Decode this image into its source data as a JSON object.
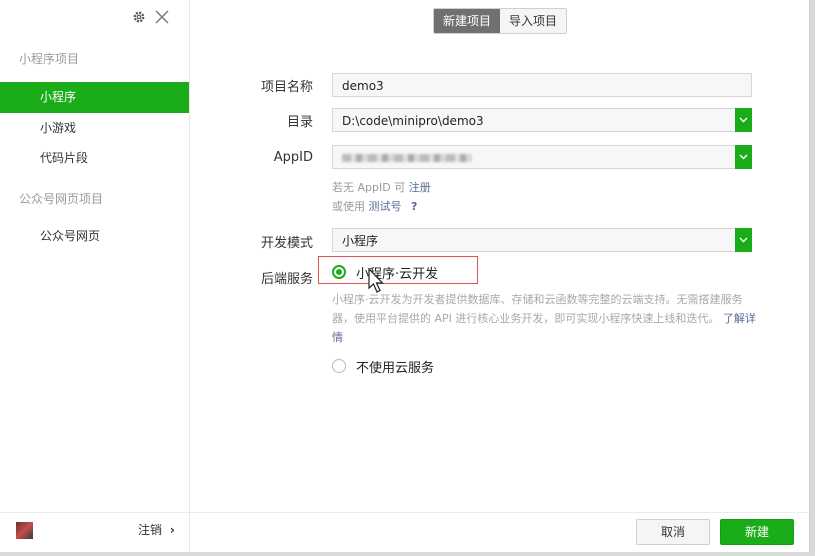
{
  "sidebar": {
    "groups": [
      {
        "title": "小程序项目",
        "items": [
          {
            "label": "小程序",
            "active": true
          },
          {
            "label": "小游戏",
            "active": false
          },
          {
            "label": "代码片段",
            "active": false
          }
        ]
      },
      {
        "title": "公众号网页项目",
        "items": [
          {
            "label": "公众号网页",
            "active": false
          }
        ]
      }
    ],
    "logout_label": "注销",
    "logout_chevron": "›"
  },
  "tabs": [
    {
      "label": "新建项目",
      "active": true
    },
    {
      "label": "导入项目",
      "active": false
    }
  ],
  "form": {
    "project_name": {
      "label": "项目名称",
      "value": "demo3"
    },
    "directory": {
      "label": "目录",
      "value": "D:\\code\\minipro\\demo3"
    },
    "appid": {
      "label": "AppID"
    },
    "appid_hint": {
      "line1_prefix": "若无 AppID 可",
      "line1_link": "注册",
      "line2_prefix": "或使用",
      "line2_link": "测试号",
      "help": "?"
    },
    "dev_mode": {
      "label": "开发模式",
      "value": "小程序"
    },
    "backend": {
      "label": "后端服务",
      "option_cloud": "小程序·云开发",
      "cloud_desc": "小程序·云开发为开发者提供数据库、存储和云函数等完整的云端支持。无需搭建服务器，使用平台提供的 API 进行核心业务开发，即可实现小程序快速上线和迭代。",
      "learn_more": "了解详情",
      "option_none": "不使用云服务",
      "selected": "cloud"
    }
  },
  "footer": {
    "cancel_label": "取消",
    "create_label": "新建"
  },
  "colors": {
    "accent": "#1aad19",
    "link": "#576b95",
    "highlight": "#e0554f"
  },
  "icons": [
    "gear-icon",
    "close-icon",
    "chevron-down-icon",
    "avatar",
    "mouse-cursor-icon"
  ]
}
